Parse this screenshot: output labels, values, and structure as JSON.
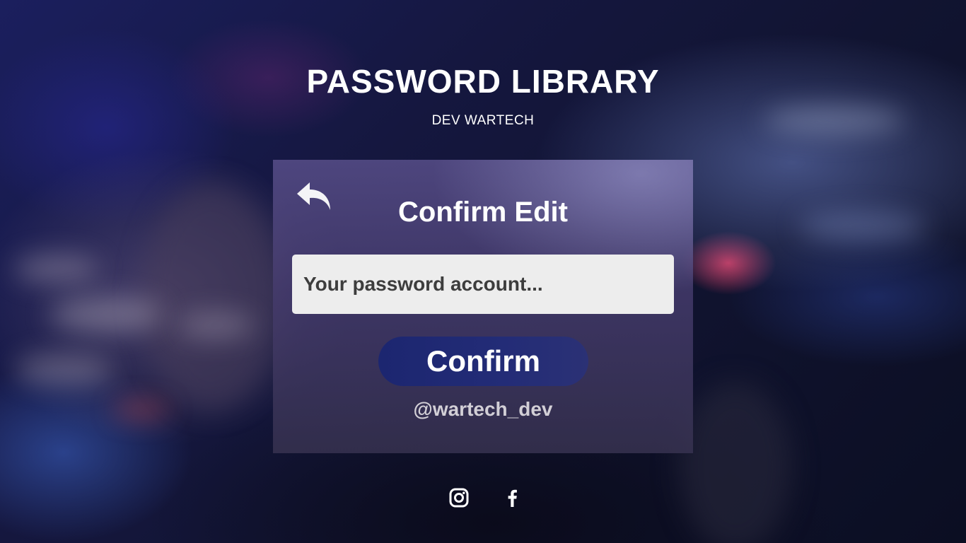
{
  "header": {
    "title": "PASSWORD LIBRARY",
    "subtitle": "DEV WARTECH"
  },
  "card": {
    "back_icon": "reply-arrow-icon",
    "title": "Confirm Edit",
    "password_input": {
      "placeholder": "Your password account...",
      "value": ""
    },
    "confirm_label": "Confirm",
    "handle": "@wartech_dev"
  },
  "social": [
    {
      "icon": "instagram-icon"
    },
    {
      "icon": "facebook-icon"
    }
  ],
  "colors": {
    "input_background": "#ededed",
    "input_text": "#3d3d3d",
    "confirm_button": "#1c2670",
    "handle_text": "#d2cfd6",
    "title_text": "#ffffff"
  }
}
